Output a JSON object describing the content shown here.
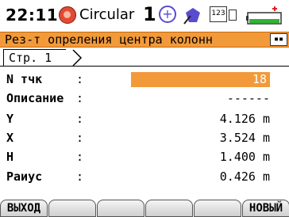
{
  "status": {
    "time": "22:11",
    "mode": "Circular",
    "face_number": "1",
    "keypad_label": "123"
  },
  "title": "Рез-т опреления центра колонн",
  "page_tab": "Стр. 1",
  "rows": [
    {
      "label": "N тчк",
      "value": "18"
    },
    {
      "label": "Описание",
      "value": "------"
    },
    {
      "label": "Y",
      "value": "4.126 m"
    },
    {
      "label": "X",
      "value": "3.524 m"
    },
    {
      "label": "H",
      "value": "1.400 m"
    },
    {
      "label": "Раиус",
      "value": "0.426 m"
    }
  ],
  "softkeys": [
    "ВЫХОД",
    "",
    "",
    "",
    "",
    "НОВЫЙ"
  ],
  "colors": {
    "accent": "#f29a3a",
    "target": "#5a4bd1",
    "battery": "#2fb335"
  }
}
